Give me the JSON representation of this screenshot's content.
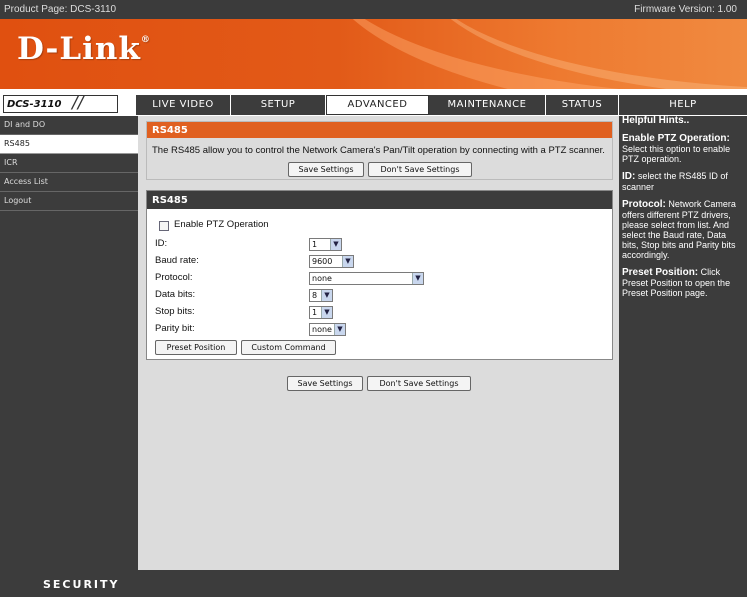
{
  "topbar": {
    "product": "Product Page: DCS-3110",
    "firmware": "Firmware Version: 1.00"
  },
  "brand": {
    "logo": "D-Link",
    "reg": "®"
  },
  "model": {
    "label": "DCS-3110",
    "slashes": "//"
  },
  "tabs": [
    "LIVE VIDEO",
    "SETUP",
    "ADVANCED",
    "MAINTENANCE",
    "STATUS",
    "HELP"
  ],
  "active_tab": "ADVANCED",
  "sidebar": {
    "items": [
      "DI and DO",
      "RS485",
      "ICR",
      "Access List",
      "Logout"
    ],
    "active": "RS485"
  },
  "intro": {
    "title": "RS485",
    "description": "The RS485 allow you to control the Network Camera's Pan/Tilt operation by connecting with a PTZ scanner.",
    "save_label": "Save Settings",
    "dont_save_label": "Don't Save Settings"
  },
  "rs485": {
    "title": "RS485",
    "enable_label": "Enable PTZ Operation",
    "enable_checked": false,
    "id_label": "ID:",
    "id_value": "1",
    "baud_label": "Baud rate:",
    "baud_value": "9600",
    "protocol_label": "Protocol:",
    "protocol_value": "none",
    "data_bits_label": "Data bits:",
    "data_bits_value": "8",
    "stop_bits_label": "Stop bits:",
    "stop_bits_value": "1",
    "parity_label": "Parity bit:",
    "parity_value": "none",
    "preset_label": "Preset Position",
    "custom_label": "Custom Command"
  },
  "bottom": {
    "save_label": "Save Settings",
    "dont_save_label": "Don't Save Settings"
  },
  "helper": {
    "title": "Helpful Hints..",
    "hints": [
      {
        "term": "Enable PTZ Operation:",
        "text": "Select this option to enable PTZ operation."
      },
      {
        "term": "ID:",
        "text": "select the RS485 ID of scanner"
      },
      {
        "term": "Protocol:",
        "text": "Network Camera offers different PTZ drivers, please select from list. And select the Baud rate, Data bits, Stop bits and Parity bits accordingly."
      },
      {
        "term": "Preset Position:",
        "text": "Click Preset Position to open the Preset Position page."
      }
    ]
  },
  "footer": {
    "label": "SECURITY"
  },
  "colors": {
    "accent": "#e06020",
    "dark": "#3c3c3c",
    "panel": "#dcdcdc"
  },
  "icons": {
    "dropdown": "chevron-down-icon",
    "checkbox": "checkbox-icon"
  }
}
